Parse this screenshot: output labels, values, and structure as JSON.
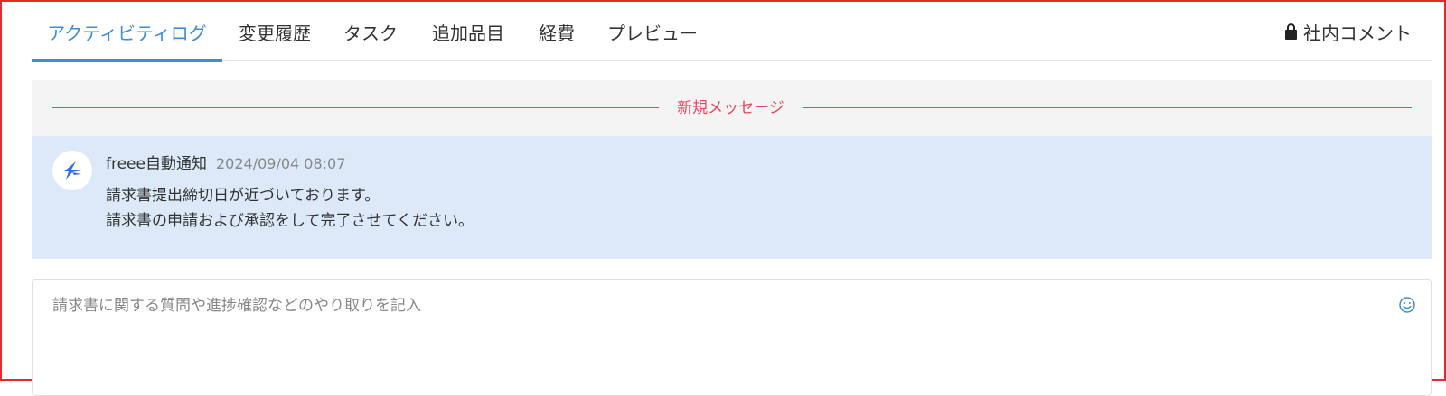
{
  "tabs": [
    {
      "label": "アクティビティログ",
      "active": true
    },
    {
      "label": "変更履歴",
      "active": false
    },
    {
      "label": "タスク",
      "active": false
    },
    {
      "label": "追加品目",
      "active": false
    },
    {
      "label": "経費",
      "active": false
    },
    {
      "label": "プレビュー",
      "active": false
    }
  ],
  "internal_comment": {
    "label": "社内コメント",
    "icon": "lock-icon"
  },
  "new_message_divider": {
    "label": "新規メッセージ"
  },
  "message": {
    "author": "freee自動通知",
    "timestamp": "2024/09/04 08:07",
    "lines": [
      "請求書提出締切日が近づいております。",
      "請求書の申請および承認をして完了させてください。"
    ],
    "avatar_icon": "freee-bird-icon"
  },
  "composer": {
    "placeholder": "請求書に関する質問や進捗確認などのやり取りを記入",
    "value": "",
    "emoji_icon": "smiley-icon"
  },
  "colors": {
    "accent": "#3c8ed9",
    "new_message": "#e8445f",
    "message_bg": "#dce9f8",
    "frame": "#e52a2a"
  }
}
